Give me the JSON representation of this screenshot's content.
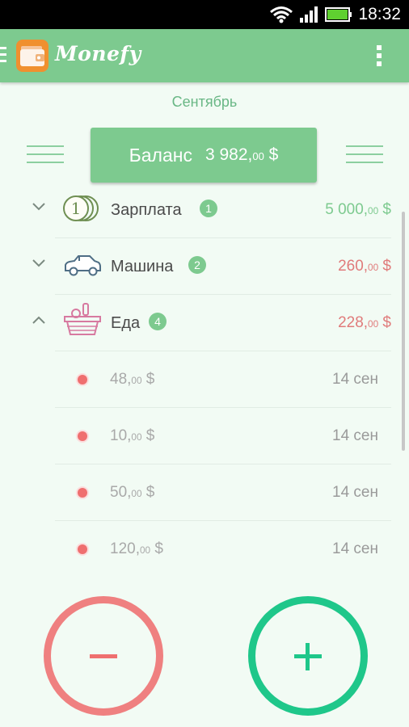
{
  "status_bar": {
    "time": "18:32"
  },
  "app": {
    "title": "Monefy",
    "accent": "#7dca8f"
  },
  "month": "Сентябрь",
  "balance": {
    "label": "Баланс",
    "amount_main": "3 982,",
    "amount_cents": "00",
    "currency": " $"
  },
  "categories": [
    {
      "name": "Зарплата",
      "count": "1",
      "amount_main": "5 000,",
      "amount_cents": "00",
      "currency": " $",
      "type": "income",
      "icon": "coins-icon",
      "expanded": false
    },
    {
      "name": "Машина",
      "count": "2",
      "amount_main": "260,",
      "amount_cents": "00",
      "currency": " $",
      "type": "expense",
      "icon": "car-icon",
      "expanded": false
    },
    {
      "name": "Еда",
      "count": "4",
      "amount_main": "228,",
      "amount_cents": "00",
      "currency": " $",
      "type": "expense",
      "icon": "food-basket-icon",
      "expanded": true
    }
  ],
  "transactions": [
    {
      "amount_main": "48,",
      "amount_cents": "00",
      "currency": " $",
      "date": "14 сен"
    },
    {
      "amount_main": "10,",
      "amount_cents": "00",
      "currency": " $",
      "date": "14 сен"
    },
    {
      "amount_main": "50,",
      "amount_cents": "00",
      "currency": " $",
      "date": "14 сен"
    },
    {
      "amount_main": "120,",
      "amount_cents": "00",
      "currency": " $",
      "date": "14 сен"
    }
  ],
  "colors": {
    "income": "#7dca8f",
    "expense": "#e07b7b",
    "minus_button": "#ef8080",
    "plus_button": "#1fc78a"
  }
}
